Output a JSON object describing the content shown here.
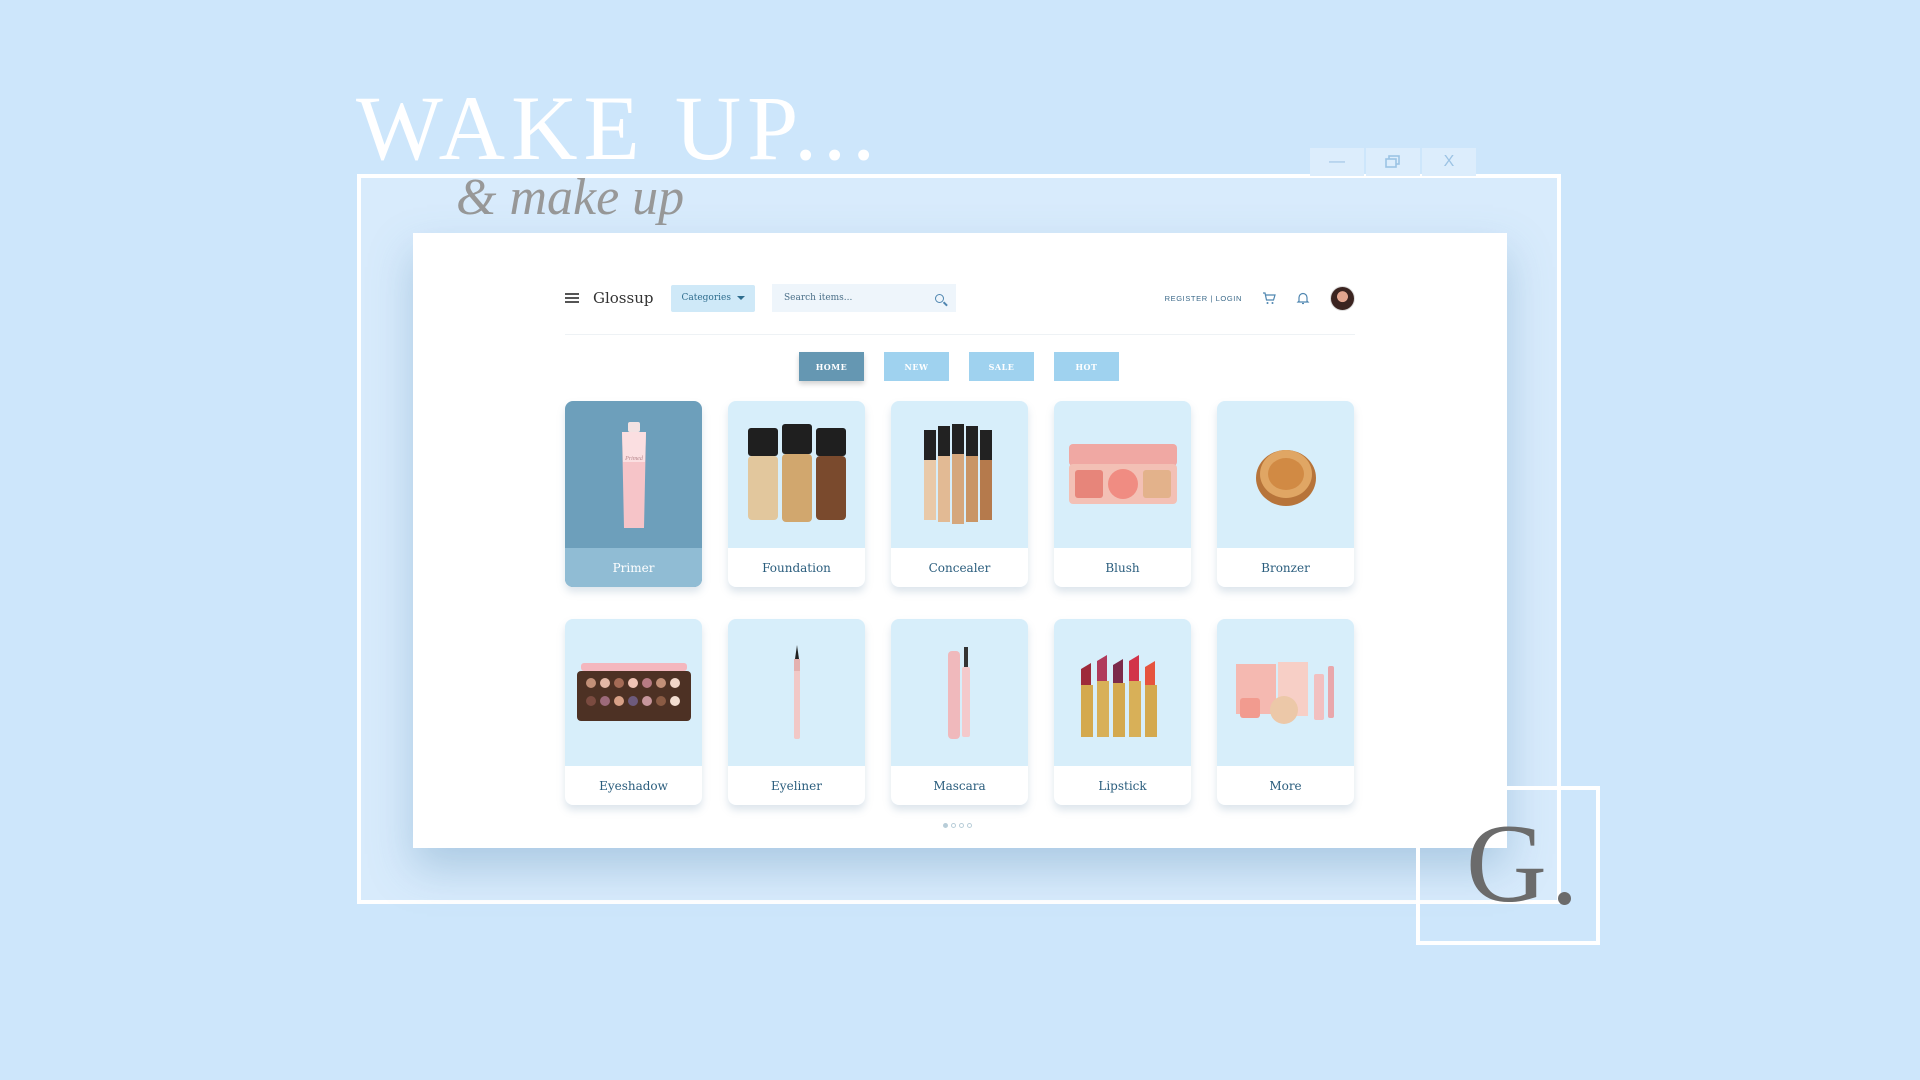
{
  "hero": {
    "title": "WAKE UP...",
    "subtitle": "& make up"
  },
  "window": {
    "minimize_label": "—",
    "restore_icon": "restore-icon",
    "close_label": "X"
  },
  "app": {
    "brand": "Glossup",
    "categories_label": "Categories",
    "search_placeholder": "Search items...",
    "register_login": "REGISTER | LOGIN",
    "tabs": [
      {
        "label": "HOME",
        "active": true
      },
      {
        "label": "NEW"
      },
      {
        "label": "SALE"
      },
      {
        "label": "HOT"
      }
    ],
    "products": [
      {
        "label": "Primer",
        "icon": "primer-tube"
      },
      {
        "label": "Foundation",
        "icon": "foundation-bottles"
      },
      {
        "label": "Concealer",
        "icon": "concealer-tubes"
      },
      {
        "label": "Blush",
        "icon": "blush-palette"
      },
      {
        "label": "Bronzer",
        "icon": "bronzer-compact"
      },
      {
        "label": "Eyeshadow",
        "icon": "eyeshadow-palette"
      },
      {
        "label": "Eyeliner",
        "icon": "eyeliner-pen"
      },
      {
        "label": "Mascara",
        "icon": "mascara-wand"
      },
      {
        "label": "Lipstick",
        "icon": "lipstick-set"
      },
      {
        "label": "More",
        "icon": "assorted-products"
      }
    ],
    "pager": {
      "pages": 4,
      "current": 1
    }
  },
  "logo": {
    "letter": "G"
  },
  "colors": {
    "background": "#cde6fb",
    "card": "#d7eefa",
    "active_card": "#6d9fbb",
    "accent": "#2a5d7d"
  }
}
